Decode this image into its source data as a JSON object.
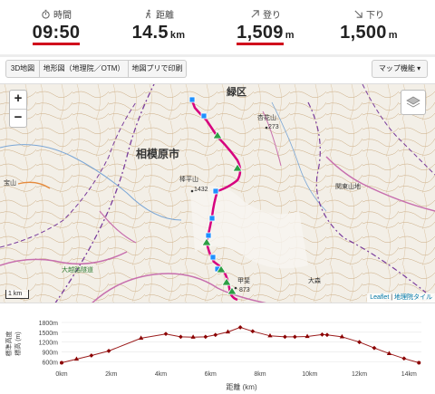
{
  "stats": {
    "time": {
      "label": "時間",
      "value": "09:50",
      "unit": ""
    },
    "distance": {
      "label": "距離",
      "value": "14.5",
      "unit": "km"
    },
    "ascent": {
      "label": "登り",
      "value": "1,509",
      "unit": "m"
    },
    "descent": {
      "label": "下り",
      "value": "1,500",
      "unit": "m"
    }
  },
  "toolbar": {
    "tab_3d": "3D地図",
    "tab_gsi": "地形図（地理院／OTM）",
    "tab_print": "地図プリで印刷",
    "map_menu": "マップ機能 ▾"
  },
  "map": {
    "zoom_in": "+",
    "zoom_out": "−",
    "scale": "1 km",
    "attribution_leaflet": "Leaflet",
    "attribution_gsi": "地理院タイル",
    "labels": {
      "ward": "緑区",
      "city": "相模原市",
      "peak1": "273",
      "peak2": "1432",
      "mt_a": "棒平山",
      "mt_b": "甲斐",
      "mt_c": "関東山地",
      "mt_d": "大森",
      "peak3": "873",
      "left1": "宝山",
      "left2": "大越路隧道",
      "right1": "杏花山"
    }
  },
  "chart_data": {
    "type": "line",
    "ylabel": "標高 (m)",
    "ylabel_left": "標準高度",
    "xlabel": "距離 (km)",
    "xlim": [
      0,
      14.5
    ],
    "ylim": [
      500,
      1800
    ],
    "y_ticks": [
      "1800m",
      "1500m",
      "1200m",
      "900m",
      "600m"
    ],
    "x_ticks": [
      "0km",
      "2km",
      "4km",
      "6km",
      "8km",
      "10km",
      "12km",
      "14km"
    ],
    "x": [
      0,
      0.6,
      1.2,
      1.9,
      3.2,
      4.2,
      4.8,
      5.3,
      5.8,
      6.2,
      6.7,
      7.2,
      7.7,
      8.4,
      9.0,
      9.4,
      9.9,
      10.5,
      10.7,
      11.3,
      12.0,
      12.6,
      13.2,
      13.8,
      14.4
    ],
    "y": [
      570,
      680,
      790,
      930,
      1320,
      1450,
      1360,
      1350,
      1360,
      1420,
      1510,
      1650,
      1530,
      1390,
      1360,
      1360,
      1370,
      1430,
      1420,
      1360,
      1200,
      1020,
      850,
      700,
      570
    ],
    "marker_colors": {
      "line": "#9b1c1c",
      "marker": "#8b0000"
    }
  }
}
